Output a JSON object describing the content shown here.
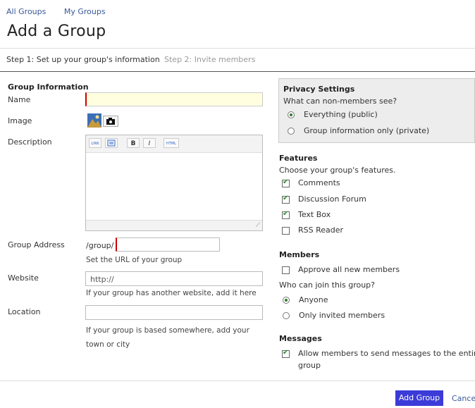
{
  "nav": {
    "all_groups": "All Groups",
    "my_groups": "My Groups"
  },
  "page_title": "Add a Group",
  "steps": {
    "step1": "Step 1: Set up your group's information",
    "step2": "Step 2: Invite members"
  },
  "group_info": {
    "heading": "Group Information",
    "name_label": "Name",
    "image_label": "Image",
    "description_label": "Description",
    "toolbar": {
      "link": "LINK",
      "b": "B",
      "i": "I",
      "html": "HTML"
    },
    "address_label": "Group Address",
    "address_prefix": "/group/",
    "address_hint": "Set the URL of your group",
    "website_label": "Website",
    "website_value": "http://",
    "website_hint": "If your group has another website, add it here",
    "location_label": "Location",
    "location_hint": "If your group is based somewhere, add your town or city"
  },
  "privacy": {
    "heading": "Privacy Settings",
    "question": "What can non-members see?",
    "opt1": "Everything (public)",
    "opt2": "Group information only (private)"
  },
  "features": {
    "heading": "Features",
    "subtext": "Choose your group's features.",
    "items": [
      "Comments",
      "Discussion Forum",
      "Text Box",
      "RSS Reader"
    ]
  },
  "members": {
    "heading": "Members",
    "approve": "Approve all new members",
    "question": "Who can join this group?",
    "opt1": "Anyone",
    "opt2": "Only invited members"
  },
  "messages": {
    "heading": "Messages",
    "allow_line1": "Allow members to send messages to the entire",
    "allow_line2": "group"
  },
  "footer": {
    "add_button": "Add Group",
    "cancel": "Cance"
  }
}
